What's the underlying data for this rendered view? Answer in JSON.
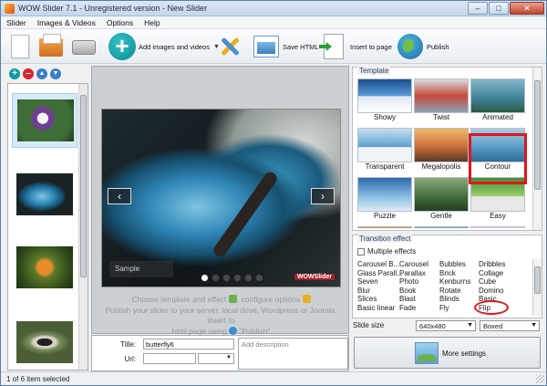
{
  "window": {
    "title": "WOW Slider 7.1 - Unregistered version - New Slider"
  },
  "menu": [
    "Slider",
    "Images & Videos",
    "Options",
    "Help"
  ],
  "toolbar": {
    "add_label": "Add images and videos",
    "save_html_label": "Save HTML",
    "insert_label": "Insert to page",
    "publish_label": "Publish"
  },
  "preview": {
    "caption": "Sample",
    "watermark": "WOWSlider",
    "help_line1": "Choose template and effect",
    "help_line1b": ", configure options",
    "help_line2": "Publish your slider to your server, local drive, Wordpress or Joomla, insert to",
    "help_line3": "html page using",
    "help_line3b": "\"Publish\""
  },
  "fields": {
    "title_label": "Title:",
    "title_value": "butterfly6",
    "url_label": "Url:",
    "url_value": "",
    "description_placeholder": "Add description"
  },
  "template": {
    "group_title": "Template",
    "items": [
      "Showy",
      "Twist",
      "Animated",
      "Transparent",
      "Megalopolis",
      "Contour",
      "Puzzle",
      "Gentle",
      "Easy"
    ],
    "selected": "Contour"
  },
  "transition": {
    "group_title": "Transition effect",
    "multiple_label": "Multiple effects",
    "columns": [
      [
        "Carousel B...",
        "Glass Parall...",
        "Seven",
        "Blur",
        "Slices",
        "Basic linear"
      ],
      [
        "Carousel",
        "Parallax",
        "Photo",
        "Book",
        "Blast",
        "Fade"
      ],
      [
        "Bubbles",
        "Brick",
        "Kenburns",
        "Rotate",
        "Blinds",
        "Fly"
      ],
      [
        "Dribbles",
        "Collage",
        "Cube",
        "Domino",
        "Basic",
        "Flip"
      ]
    ],
    "selected": "Cube"
  },
  "slide_size": {
    "label": "Slide size",
    "size_value": "640x480",
    "fit_value": "Boxed"
  },
  "more_settings_label": "More settings",
  "status": "1 of 6 item selected",
  "colors": {
    "accent_teal": "#0c9ba2",
    "highlight_red": "#e3151b"
  }
}
